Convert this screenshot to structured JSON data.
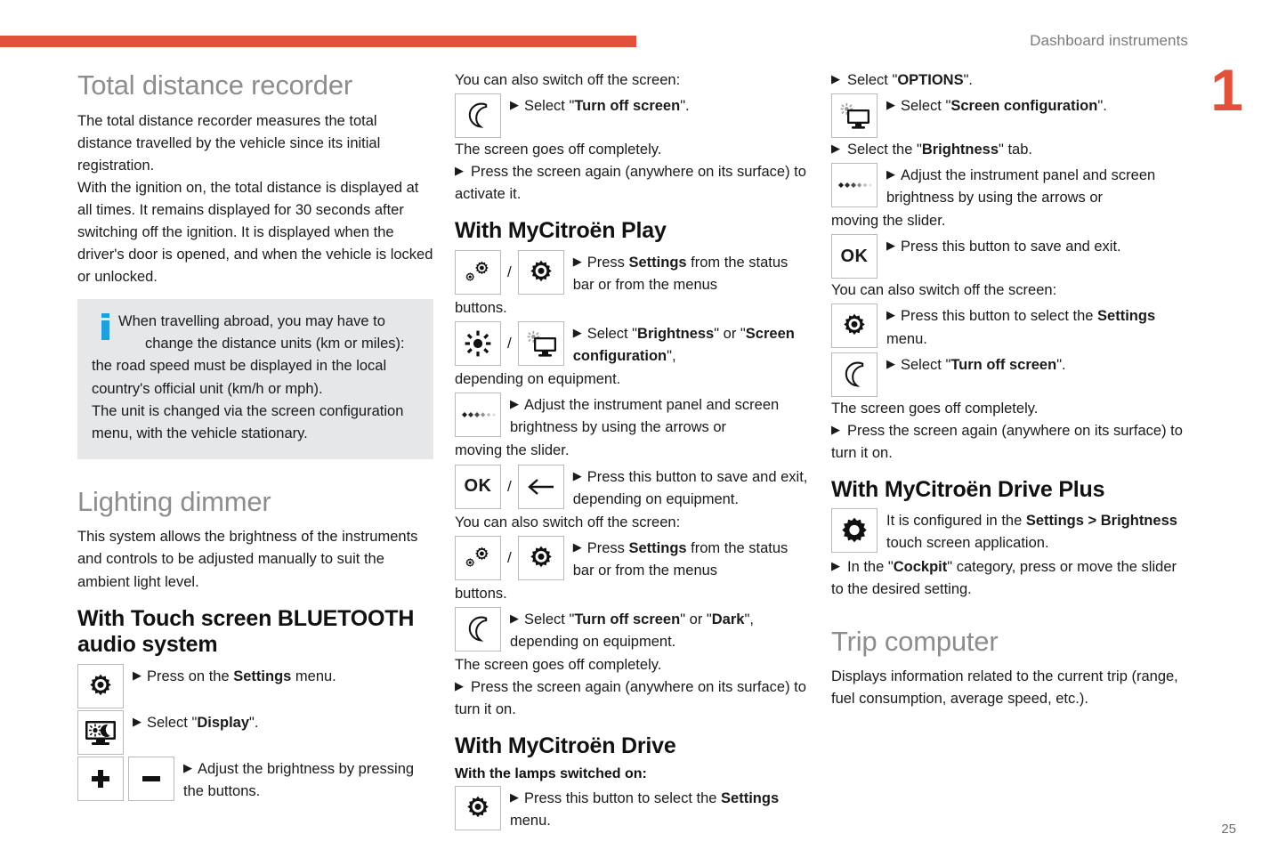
{
  "header": {
    "title": "Dashboard instruments",
    "chapter": "1",
    "page_number": "25",
    "accent_color": "#e2513c"
  },
  "col1": {
    "section_title": "Total distance recorder",
    "para1": "The total distance recorder measures the total distance travelled by the vehicle since its initial registration.",
    "para2": "With the ignition on, the total distance is displayed at all times. It remains displayed for 30 seconds after switching off the ignition. It is displayed when the driver's door is opened, and when the vehicle is locked or unlocked.",
    "callout": {
      "icon": "info-icon",
      "line1": "When travelling abroad, you may have to",
      "line2": "change the distance units (km or miles):",
      "rest": "the road speed must be displayed in the local country's official unit (km/h or mph).\nThe unit is changed via the screen configuration menu, with the vehicle stationary."
    },
    "section_title_2": "Lighting dimmer",
    "para3": "This system allows the brightness of the instruments and controls to be adjusted manually to suit the ambient light level.",
    "subheading": "With Touch screen BLUETOOTH audio system",
    "steps": [
      {
        "icons": [
          "gear-dot-icon"
        ],
        "text_parts": [
          {
            "t": "Press on the ",
            "b": false
          },
          {
            "t": "Settings",
            "b": true
          },
          {
            "t": " menu.",
            "b": false
          }
        ]
      },
      {
        "icons": [
          "monitor-sun-moon-icon"
        ],
        "text_parts": [
          {
            "t": "Select \"",
            "b": false
          },
          {
            "t": "Display",
            "b": true
          },
          {
            "t": "\".",
            "b": false
          }
        ]
      },
      {
        "icons": [
          "plus-icon",
          "minus-icon"
        ],
        "text_parts": [
          {
            "t": "Adjust the brightness by pressing the buttons.",
            "b": false
          }
        ]
      }
    ]
  },
  "col2": {
    "intro": "You can also switch off the screen:",
    "step_moon": {
      "icons": [
        "moon-icon"
      ],
      "text_parts": [
        {
          "t": "Select \"",
          "b": false
        },
        {
          "t": "Turn off screen",
          "b": true
        },
        {
          "t": "\".",
          "b": false
        }
      ]
    },
    "after_moon_1": "The screen goes off completely.",
    "after_moon_2": "Press the screen again (anywhere on its surface) to activate it.",
    "heading_play": "With MyCitroën Play",
    "play_steps": [
      {
        "icons": [
          "two-gears-icon",
          "gear-dot-icon"
        ],
        "text_parts": [
          {
            "t": "Press ",
            "b": false
          },
          {
            "t": "Settings",
            "b": true
          },
          {
            "t": " from the status bar or from the menus",
            "b": false
          }
        ],
        "tail": "buttons."
      },
      {
        "icons": [
          "sun-icon",
          "monitor-sun-icon"
        ],
        "text_parts": [
          {
            "t": "Select \"",
            "b": false
          },
          {
            "t": "Brightness",
            "b": true
          },
          {
            "t": "\" or \"",
            "b": false
          },
          {
            "t": "Screen configuration",
            "b": true
          },
          {
            "t": "\",",
            "b": false
          }
        ],
        "tail": "depending on equipment."
      },
      {
        "icons": [
          "slider-icon"
        ],
        "text_parts": [
          {
            "t": "Adjust the instrument panel and screen brightness by using the arrows or",
            "b": false
          }
        ],
        "tail": "moving the slider."
      },
      {
        "icons": [
          "ok-icon",
          "back-arrow-icon"
        ],
        "text_parts": [
          {
            "t": "Press this button to save and exit, depending on equipment.",
            "b": false
          }
        ]
      }
    ],
    "switch_off_label": "You can also switch off the screen:",
    "play_off_steps": [
      {
        "icons": [
          "two-gears-icon",
          "gear-dot-icon"
        ],
        "text_parts": [
          {
            "t": "Press ",
            "b": false
          },
          {
            "t": "Settings",
            "b": true
          },
          {
            "t": " from the status bar or from the menus",
            "b": false
          }
        ],
        "tail": "buttons."
      },
      {
        "icons": [
          "moon-icon"
        ],
        "text_parts": [
          {
            "t": "Select \"",
            "b": false
          },
          {
            "t": "Turn off screen",
            "b": true
          },
          {
            "t": "\" or \"",
            "b": false
          },
          {
            "t": "Dark",
            "b": true
          },
          {
            "t": "\", depending on equipment.",
            "b": false
          }
        ]
      }
    ],
    "off_note_1": "The screen goes off completely.",
    "off_note_2": "Press the screen again (anywhere on its surface) to turn it on.",
    "heading_drive": "With MyCitroën Drive",
    "drive_subheading": "With the lamps switched on:",
    "drive_step": {
      "icons": [
        "gear-dot-icon"
      ],
      "text_parts": [
        {
          "t": "Press this button to select the ",
          "b": false
        },
        {
          "t": "Settings",
          "b": true
        },
        {
          "t": " menu.",
          "b": false
        }
      ]
    }
  },
  "col3": {
    "line_options": {
      "text_parts": [
        {
          "t": "Select \"",
          "b": false
        },
        {
          "t": "OPTIONS",
          "b": true
        },
        {
          "t": "\".",
          "b": false
        }
      ]
    },
    "step_screen_config": {
      "icons": [
        "monitor-sun-icon"
      ],
      "text_parts": [
        {
          "t": "Select \"",
          "b": false
        },
        {
          "t": "Screen configuration",
          "b": true
        },
        {
          "t": "\".",
          "b": false
        }
      ]
    },
    "line_brightness_tab": {
      "text_parts": [
        {
          "t": "Select the \"",
          "b": false
        },
        {
          "t": "Brightness",
          "b": true
        },
        {
          "t": "\" tab.",
          "b": false
        }
      ]
    },
    "step_slider": {
      "icons": [
        "slider-icon"
      ],
      "text_parts": [
        {
          "t": "Adjust the instrument panel and screen brightness by using the arrows or",
          "b": false
        }
      ],
      "tail": "moving the slider."
    },
    "step_ok": {
      "icons": [
        "ok-icon"
      ],
      "text_parts": [
        {
          "t": "Press this button to save and exit.",
          "b": false
        }
      ]
    },
    "switch_off_label": "You can also switch off the screen:",
    "step_settings": {
      "icons": [
        "gear-dot-icon"
      ],
      "text_parts": [
        {
          "t": "Press this button to select the ",
          "b": false
        },
        {
          "t": "Settings",
          "b": true
        },
        {
          "t": " menu.",
          "b": false
        }
      ]
    },
    "step_moon": {
      "icons": [
        "moon-icon"
      ],
      "text_parts": [
        {
          "t": "Select \"",
          "b": false
        },
        {
          "t": "Turn off screen",
          "b": true
        },
        {
          "t": "\".",
          "b": false
        }
      ]
    },
    "off_note_1": "The screen goes off completely.",
    "off_note_2": "Press the screen again (anywhere on its surface) to turn it on.",
    "heading_drive_plus": "With MyCitroën Drive Plus",
    "drive_plus_step": {
      "icons": [
        "gear-solid-icon"
      ],
      "text_parts": [
        {
          "t": "It is configured in the ",
          "b": false
        },
        {
          "t": "Settings > Brightness",
          "b": true
        },
        {
          "t": " touch screen application.",
          "b": false
        }
      ]
    },
    "drive_plus_line": {
      "text_parts": [
        {
          "t": "In the \"",
          "b": false
        },
        {
          "t": "Cockpit",
          "b": true
        },
        {
          "t": "\" category, press or move the slider to the desired setting.",
          "b": false
        }
      ]
    },
    "section_title_trip": "Trip computer",
    "trip_para": "Displays information related to the current trip (range, fuel consumption, average speed, etc.)."
  }
}
